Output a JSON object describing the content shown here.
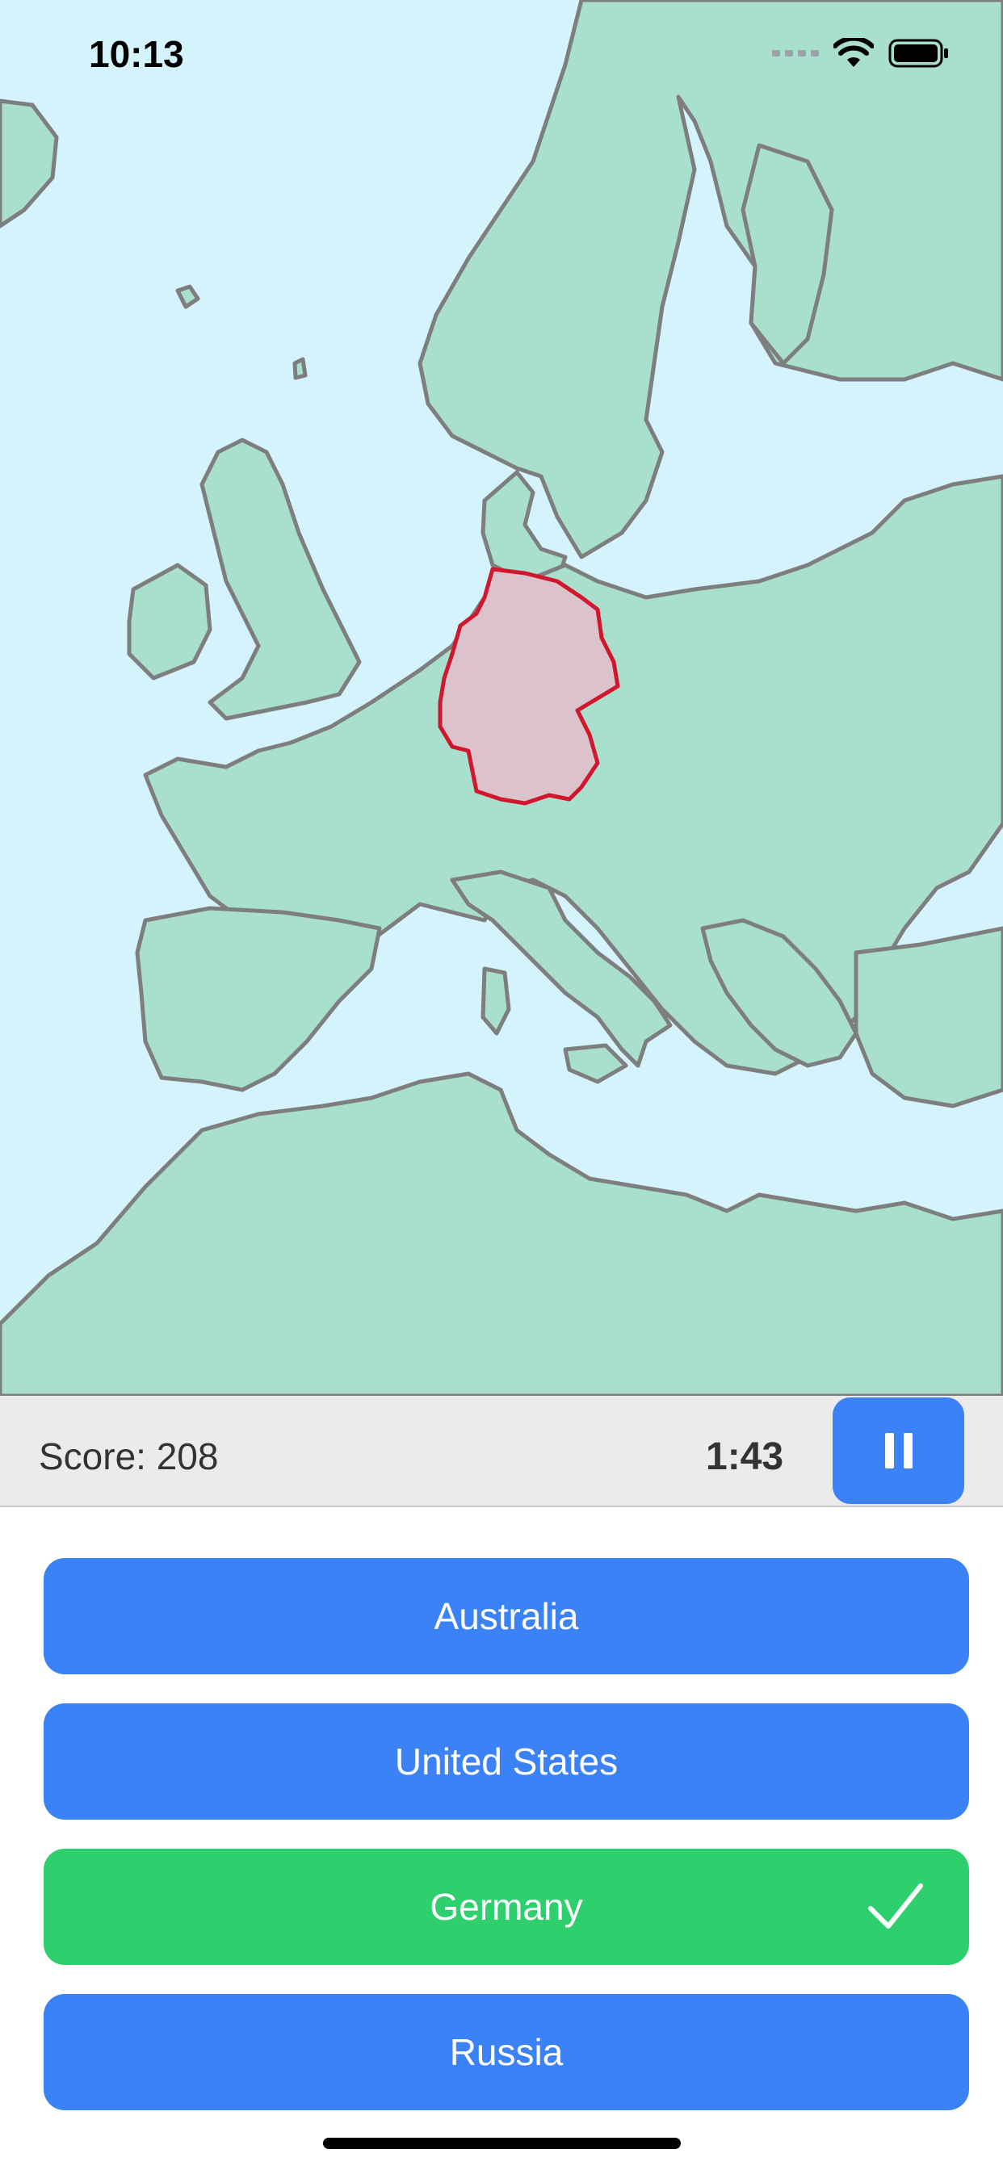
{
  "status_bar": {
    "time": "10:13",
    "icons": [
      "cellular-signal-icon",
      "wifi-icon",
      "battery-icon"
    ]
  },
  "map": {
    "highlighted_country_color": "#dcc3cb",
    "highlighted_country_border": "#d0172e",
    "land_color": "#a8dfcd",
    "water_color": "#d4f3fd"
  },
  "game_bar": {
    "score_label": "Score: 208",
    "timer": "1:43",
    "pause_icon": "pause-icon"
  },
  "answers": [
    {
      "label": "Australia",
      "state": "default"
    },
    {
      "label": "United States",
      "state": "default"
    },
    {
      "label": "Germany",
      "state": "correct"
    },
    {
      "label": "Russia",
      "state": "default"
    }
  ],
  "colors": {
    "button_blue": "#3b82f6",
    "correct_green": "#2ed06e"
  }
}
